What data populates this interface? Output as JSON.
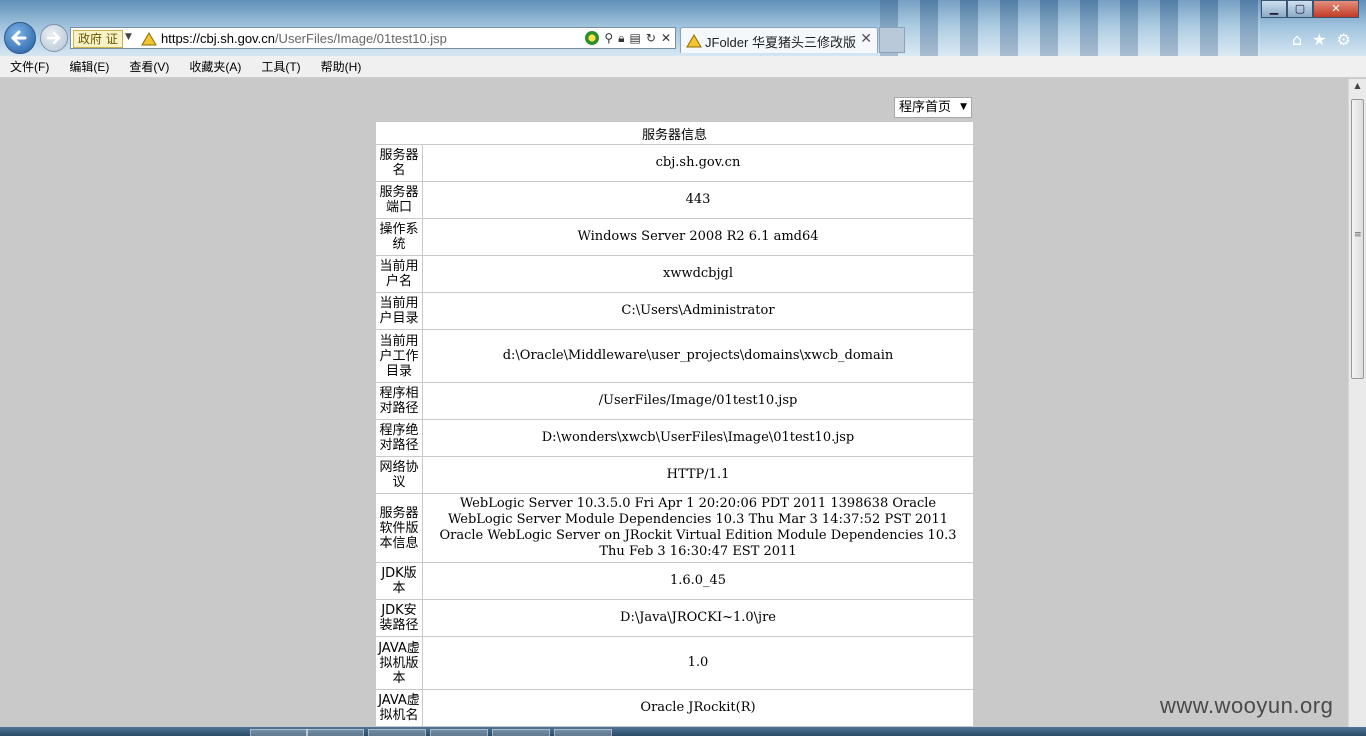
{
  "browser": {
    "gov_tag": "政府 证",
    "url_host": "https://cbj.sh.gov.cn",
    "url_path": "/UserFiles/Image/01test10.jsp",
    "tab_title": "JFolder 华夏猪头三修改版"
  },
  "menu": [
    "文件(F)",
    "编辑(E)",
    "查看(V)",
    "收藏夹(A)",
    "工具(T)",
    "帮助(H)"
  ],
  "page": {
    "select_value": "程序首页",
    "table_title": "服务器信息",
    "rows": [
      {
        "label": "服务器名",
        "value": "cbj.sh.gov.cn"
      },
      {
        "label": "服务器端口",
        "value": "443"
      },
      {
        "label": "操作系统",
        "value": "Windows Server 2008 R2 6.1 amd64"
      },
      {
        "label": "当前用户名",
        "value": "xwwdcbjgl"
      },
      {
        "label": "当前用户目录",
        "value": "C:\\Users\\Administrator"
      },
      {
        "label": "当前用户工作目录",
        "value": "d:\\Oracle\\Middleware\\user_projects\\domains\\xwcb_domain"
      },
      {
        "label": "程序相对路径",
        "value": "/UserFiles/Image/01test10.jsp"
      },
      {
        "label": "程序绝对路径",
        "value": "D:\\wonders\\xwcb\\UserFiles\\Image\\01test10.jsp"
      },
      {
        "label": "网络协议",
        "value": "HTTP/1.1"
      },
      {
        "label": "服务器软件版本信息",
        "value": "WebLogic Server 10.3.5.0 Fri Apr 1 20:20:06 PDT 2011 1398638 Oracle WebLogic Server Module Dependencies 10.3 Thu Mar 3 14:37:52 PST 2011 Oracle WebLogic Server on JRockit Virtual Edition Module Dependencies 10.3 Thu Feb 3 16:30:47 EST 2011"
      },
      {
        "label": "JDK版本",
        "value": "1.6.0_45"
      },
      {
        "label": "JDK安装路径",
        "value": "D:\\Java\\JROCKI~1.0\\jre"
      },
      {
        "label": "JAVA虚拟机版本",
        "value": "1.0"
      },
      {
        "label": "JAVA虚拟机名",
        "value": "Oracle JRockit(R)"
      }
    ]
  },
  "watermark": "www.wooyun.org"
}
